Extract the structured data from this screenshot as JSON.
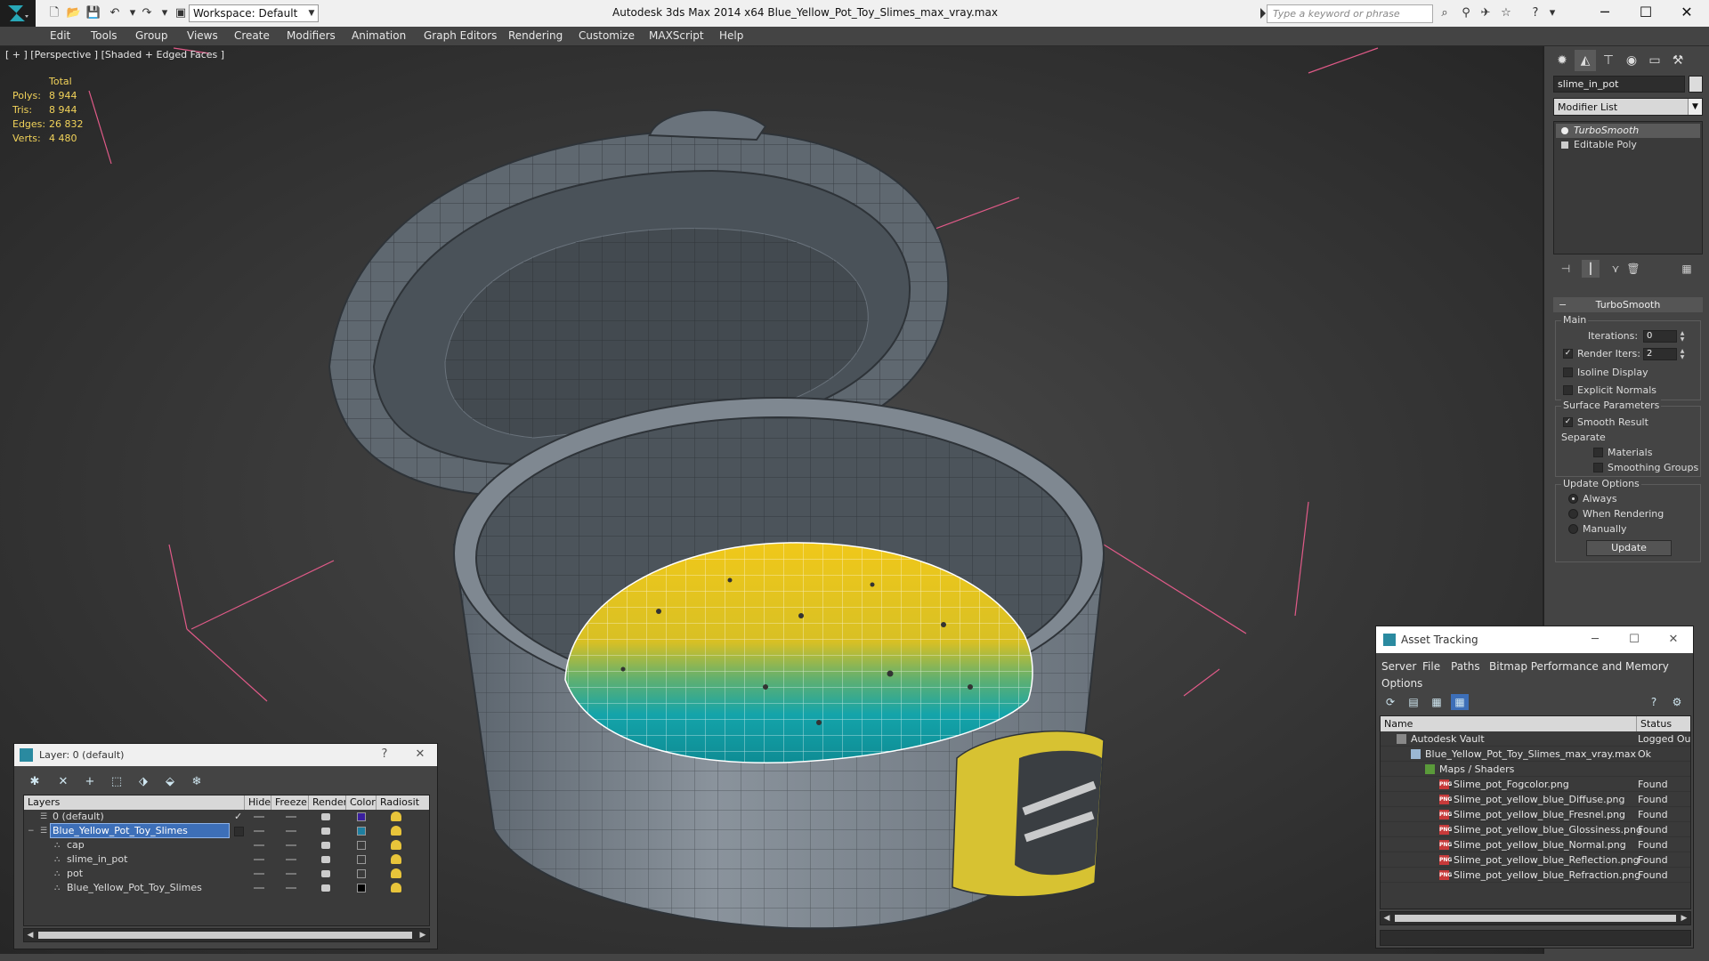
{
  "app": {
    "window_title": "Autodesk 3ds Max  2014 x64       Blue_Yellow_Pot_Toy_Slimes_max_vray.max",
    "workspace_label": "Workspace: Default",
    "search_placeholder": "Type a keyword or phrase"
  },
  "menu": [
    "Edit",
    "Tools",
    "Group",
    "Views",
    "Create",
    "Modifiers",
    "Animation",
    "Graph Editors",
    "Rendering",
    "Customize",
    "MAXScript",
    "Help"
  ],
  "viewport": {
    "label": "[ + ] [Perspective ] [Shaded + Edged Faces ]",
    "stats": {
      "header": "Total",
      "rows": [
        {
          "label": "Polys:",
          "value": "8 944"
        },
        {
          "label": "Tris:",
          "value": "8 944"
        },
        {
          "label": "Edges:",
          "value": "26 832"
        },
        {
          "label": "Verts:",
          "value": "4 480"
        }
      ]
    }
  },
  "command_panel": {
    "object_name": "slime_in_pot",
    "modifier_list": "Modifier List",
    "stack": [
      "TurboSmooth",
      "Editable Poly"
    ],
    "turbosmooth": {
      "title": "TurboSmooth",
      "main_group": "Main",
      "iterations_label": "Iterations:",
      "iterations_value": "0",
      "render_iters_label": "Render Iters:",
      "render_iters_value": "2",
      "render_iters_checked": true,
      "isoline_label": "Isoline Display",
      "explicit_normals_label": "Explicit Normals",
      "surface_group": "Surface Parameters",
      "smooth_result_label": "Smooth Result",
      "separate_label": "Separate",
      "materials_label": "Materials",
      "smoothing_groups_label": "Smoothing Groups",
      "update_group": "Update Options",
      "always_label": "Always",
      "when_rendering_label": "When Rendering",
      "manually_label": "Manually",
      "update_button": "Update"
    }
  },
  "layer_dialog": {
    "title": "Layer: 0 (default)",
    "help": "?",
    "close": "✕",
    "columns": [
      "Layers",
      "Hide",
      "Freeze",
      "Render",
      "Color",
      "Radiosit"
    ],
    "rows": [
      {
        "name": "0 (default)",
        "color": "#3a1f9e"
      },
      {
        "name": "Blue_Yellow_Pot_Toy_Slimes",
        "color": "#1e7fa0"
      },
      {
        "name": "cap",
        "color": "#3a3a3a"
      },
      {
        "name": "slime_in_pot",
        "color": "#3a3a3a"
      },
      {
        "name": "pot",
        "color": "#3a3a3a"
      },
      {
        "name": "Blue_Yellow_Pot_Toy_Slimes",
        "color": "#000000"
      }
    ]
  },
  "asset_dialog": {
    "title": "Asset Tracking",
    "menu": [
      "Server",
      "File",
      "Paths",
      "Bitmap Performance and Memory",
      "Options"
    ],
    "columns": [
      "Name",
      "Status"
    ],
    "rows": [
      {
        "name": "Autodesk Vault",
        "status": "Logged Ou"
      },
      {
        "name": "Blue_Yellow_Pot_Toy_Slimes_max_vray.max",
        "status": "Ok"
      },
      {
        "name": "Maps / Shaders",
        "status": ""
      },
      {
        "name": "Slime_pot_Fogcolor.png",
        "status": "Found"
      },
      {
        "name": "Slime_pot_yellow_blue_Diffuse.png",
        "status": "Found"
      },
      {
        "name": "Slime_pot_yellow_blue_Fresnel.png",
        "status": "Found"
      },
      {
        "name": "Slime_pot_yellow_blue_Glossiness.png",
        "status": "Found"
      },
      {
        "name": "Slime_pot_yellow_blue_Normal.png",
        "status": "Found"
      },
      {
        "name": "Slime_pot_yellow_blue_Reflection.png",
        "status": "Found"
      },
      {
        "name": "Slime_pot_yellow_blue_Refraction.png",
        "status": "Found"
      }
    ]
  },
  "colors": {
    "stats_text": "#f2d35a",
    "selection": "#3d6fb8",
    "slime_yellow": "#e7c21c",
    "slime_teal": "#13a3a8",
    "pot_gray": "#7a838c"
  }
}
